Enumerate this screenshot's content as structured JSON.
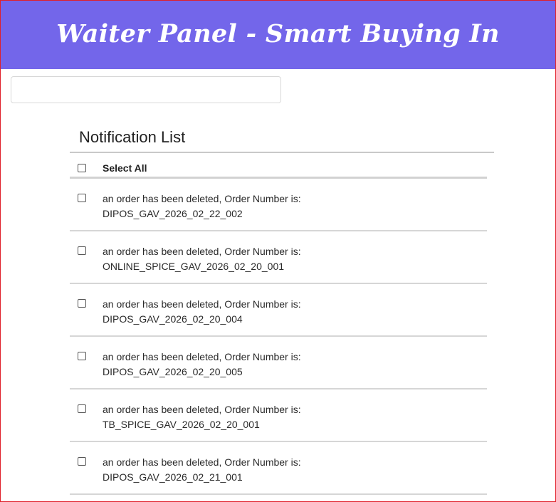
{
  "header": {
    "title": "Waiter Panel - Smart Buying In"
  },
  "search": {
    "value": "",
    "placeholder": ""
  },
  "notifications": {
    "title": "Notification List",
    "select_all_label": "Select All",
    "items": [
      {
        "message": "an order has been deleted, Order Number is:",
        "order_number": "DIPOS_GAV_2026_02_22_002"
      },
      {
        "message": "an order has been deleted, Order Number is:",
        "order_number": "ONLINE_SPICE_GAV_2026_02_20_001"
      },
      {
        "message": "an order has been deleted, Order Number is:",
        "order_number": "DIPOS_GAV_2026_02_20_004"
      },
      {
        "message": "an order has been deleted, Order Number is:",
        "order_number": "DIPOS_GAV_2026_02_20_005"
      },
      {
        "message": "an order has been deleted, Order Number is:",
        "order_number": "TB_SPICE_GAV_2026_02_20_001"
      },
      {
        "message": "an order has been deleted, Order Number is:",
        "order_number": "DIPOS_GAV_2026_02_21_001"
      }
    ]
  },
  "colors": {
    "header_bg": "#7366ea",
    "window_border": "#e0202a"
  }
}
